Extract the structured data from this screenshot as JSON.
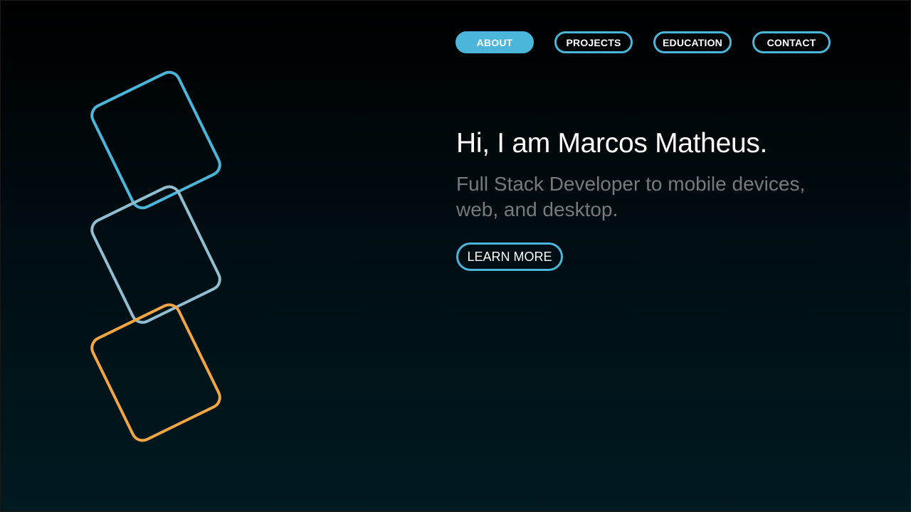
{
  "nav": {
    "items": [
      {
        "label": "ABOUT",
        "active": true
      },
      {
        "label": "PROJECTS",
        "active": false
      },
      {
        "label": "EDUCATION",
        "active": false
      },
      {
        "label": "CONTACT",
        "active": false
      }
    ]
  },
  "hero": {
    "title": "Hi, I am Marcos Matheus.",
    "subtitle": "Full Stack Developer to mobile devices, web, and desktop.",
    "cta_label": "LEARN MORE"
  },
  "colors": {
    "accent": "#4bb6d9",
    "shape_top": "#4bb6d9",
    "shape_middle": "#8fbfd0",
    "shape_bottom": "#f2a544",
    "subtitle_text": "#777a7c"
  }
}
